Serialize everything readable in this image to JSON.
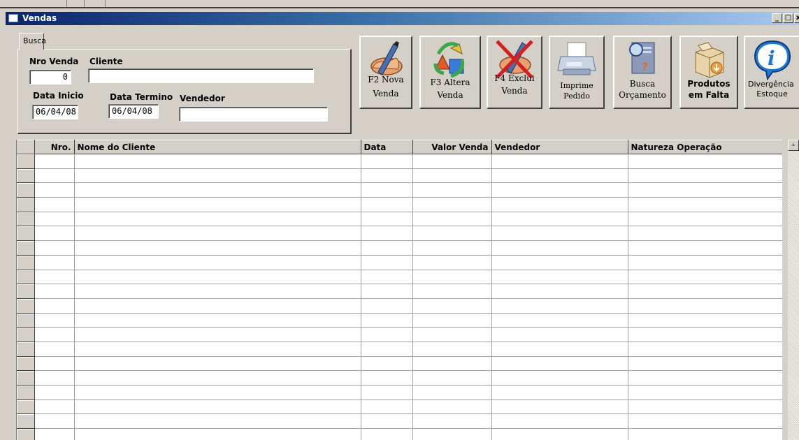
{
  "window": {
    "title": "Vendas",
    "controls": {
      "minimize": "_",
      "maximize": "□",
      "close": "x"
    }
  },
  "search": {
    "tab_label": "Busca",
    "nro_venda_label": "Nro Venda",
    "nro_venda_value": "0",
    "cliente_label": "Cliente",
    "cliente_value": "",
    "data_inicio_label": "Data Inicio",
    "data_inicio_value": "06/04/08",
    "data_termino_label": "Data Termino",
    "data_termino_value": "06/04/08",
    "vendedor_label": "Vendedor",
    "vendedor_value": ""
  },
  "toolbar": {
    "nova_venda": [
      "F2  Nova",
      "Venda"
    ],
    "altera_venda": [
      "F3  Altera",
      "Venda"
    ],
    "exclui_venda": [
      "F4 Exclui",
      "Venda"
    ],
    "imprime_pedido": [
      "Imprime",
      "Pedido"
    ],
    "busca_orcamento": [
      "Busca",
      "Orçamento"
    ],
    "produtos_falta": [
      "Produtos",
      "em Falta"
    ],
    "divergencia_estoque": [
      "Divergência",
      "Estoque"
    ]
  },
  "table": {
    "columns": [
      "Nro.",
      "Nome do Cliente",
      "Data",
      "Valor Venda",
      "Vendedor",
      "Natureza Operação"
    ],
    "rows": [
      [
        "",
        "",
        "",
        "",
        "",
        ""
      ],
      [
        "",
        "",
        "",
        "",
        "",
        ""
      ],
      [
        "",
        "",
        "",
        "",
        "",
        ""
      ],
      [
        "",
        "",
        "",
        "",
        "",
        ""
      ],
      [
        "",
        "",
        "",
        "",
        "",
        ""
      ],
      [
        "",
        "",
        "",
        "",
        "",
        ""
      ],
      [
        "",
        "",
        "",
        "",
        "",
        ""
      ],
      [
        "",
        "",
        "",
        "",
        "",
        ""
      ],
      [
        "",
        "",
        "",
        "",
        "",
        ""
      ],
      [
        "",
        "",
        "",
        "",
        "",
        ""
      ],
      [
        "",
        "",
        "",
        "",
        "",
        ""
      ],
      [
        "",
        "",
        "",
        "",
        "",
        ""
      ],
      [
        "",
        "",
        "",
        "",
        "",
        ""
      ],
      [
        "",
        "",
        "",
        "",
        "",
        ""
      ],
      [
        "",
        "",
        "",
        "",
        "",
        ""
      ],
      [
        "",
        "",
        "",
        "",
        "",
        ""
      ],
      [
        "",
        "",
        "",
        "",
        "",
        ""
      ],
      [
        "",
        "",
        "",
        "",
        "",
        ""
      ],
      [
        "",
        "",
        "",
        "",
        "",
        ""
      ],
      [
        "",
        "",
        "",
        "",
        "",
        ""
      ]
    ]
  },
  "icons": {
    "nova": "hand-pen-icon",
    "altera": "recycle-arrows-icon",
    "exclui": "hand-pen-crossed-icon",
    "imprime": "printer-icon",
    "busca": "search-document-icon",
    "produtos": "box-icon",
    "divergencia": "info-icon"
  },
  "colors": {
    "face": "#d4d0c8",
    "title_start": "#0a246a",
    "title_end": "#a6caf0",
    "info_blue": "#1f78d1",
    "delete_red": "#d42020"
  }
}
